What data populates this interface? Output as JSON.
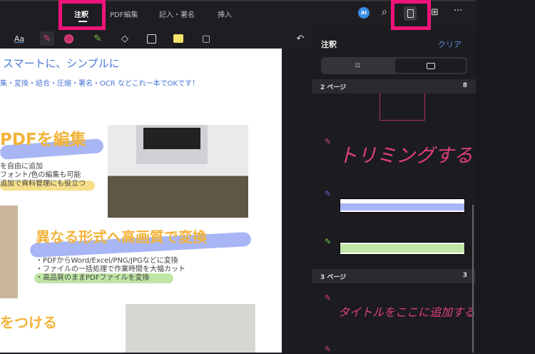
{
  "tabs": [
    {
      "label": "注釈",
      "active": true
    },
    {
      "label": "PDF編集"
    },
    {
      "label": "記入・署名"
    },
    {
      "label": "挿入"
    }
  ],
  "topbar_icons": [
    "ai-icon",
    "search-icon",
    "annotation-list-icon",
    "grid-icon",
    "more-icon"
  ],
  "ai_label": "AI",
  "toolbar": {
    "text_tool": "Aa",
    "undo": "↶"
  },
  "document": {
    "title": "スマートに、シンプルに",
    "subtitle": "集・変換・結合・圧縮・署名・OCR などこれ一本でOKです！",
    "section1": {
      "heading": "PDFを編集",
      "bullets": [
        "を自由に追加",
        "フォント/色の編集も可能",
        "追加で資料管理にも役立つ"
      ]
    },
    "section2": {
      "heading": "異なる形式へ高画質で変換",
      "bullets": [
        "・PDFからWord/Excel/PNG/JPGなどに変換",
        "・ファイルの一括処理で作業時間を大幅カット",
        "・高品質のままPDFファイルを変換"
      ]
    },
    "section3": {
      "heading": "をつける"
    }
  },
  "panel": {
    "title": "注釈",
    "clear": "クリア",
    "groups": [
      {
        "label": "2 ページ",
        "count": "8",
        "items": [
          {
            "type": "shape"
          },
          {
            "type": "ink",
            "text": "トリミングする"
          },
          {
            "type": "highlight",
            "color": "#a9b6f5"
          },
          {
            "type": "highlight",
            "color": "#bfe5a4"
          }
        ]
      },
      {
        "label": "3 ページ",
        "count": "3",
        "items": [
          {
            "type": "ink",
            "text": "タイトルをここに追加する"
          }
        ]
      }
    ]
  },
  "colors": {
    "accent_pink": "#f0147a",
    "link_blue": "#5b8de0",
    "ink_pink": "#e0407a"
  }
}
